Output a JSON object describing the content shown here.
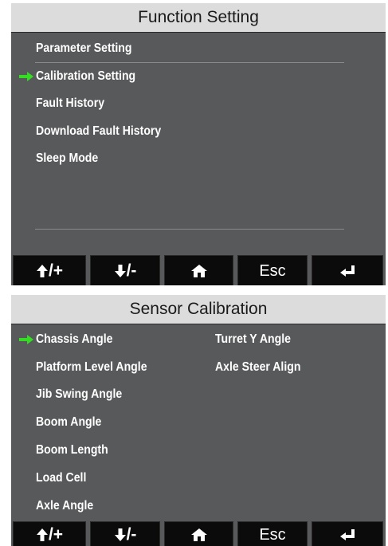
{
  "function_setting": {
    "title": "Function Setting",
    "items": [
      {
        "label": "Parameter Setting",
        "selected": false
      },
      {
        "label": "Calibration Setting",
        "selected": true
      },
      {
        "label": "Fault History",
        "selected": false
      },
      {
        "label": "Download Fault History",
        "selected": false
      },
      {
        "label": "Sleep Mode",
        "selected": false
      }
    ]
  },
  "sensor_calibration": {
    "title": "Sensor Calibration",
    "left_items": [
      {
        "label": "Chassis Angle",
        "selected": true
      },
      {
        "label": "Platform Level Angle",
        "selected": false
      },
      {
        "label": "Jib Swing Angle",
        "selected": false
      },
      {
        "label": "Boom Angle",
        "selected": false
      },
      {
        "label": "Boom Length",
        "selected": false
      },
      {
        "label": "Load Cell",
        "selected": false
      },
      {
        "label": "Axle Angle",
        "selected": false
      }
    ],
    "right_items": [
      {
        "label": "Turret Y Angle",
        "selected": false
      },
      {
        "label": "Axle Steer Align",
        "selected": false
      }
    ]
  },
  "buttons": {
    "up_plus": "/+",
    "down_minus": "/-",
    "home_icon": "home-icon",
    "esc": "Esc",
    "enter_icon": "enter-icon"
  },
  "colors": {
    "screen_bg": "#58595b",
    "title_bg": "#dcdcdc",
    "button_bg": "#0b0b0b",
    "selection_arrow": "#33dd22"
  }
}
